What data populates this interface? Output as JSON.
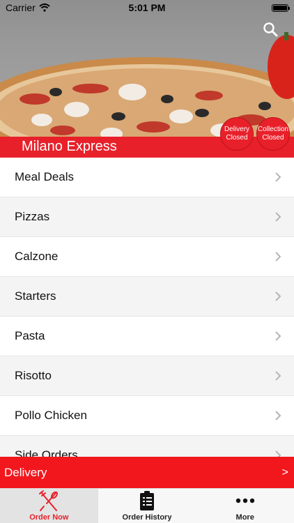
{
  "status_bar": {
    "carrier": "Carrier",
    "time": "5:01 PM",
    "wifi_icon": "wifi-icon",
    "battery_icon": "battery-icon"
  },
  "header": {
    "restaurant_name": "Milano Express",
    "search_icon": "search-icon",
    "accent_color": "#e8202a",
    "badges": {
      "delivery": {
        "line1": "Delivery",
        "line2": "Closed"
      },
      "collection": {
        "line1": "Collection",
        "line2": "Closed"
      }
    }
  },
  "menu": {
    "items": [
      {
        "label": "Meal Deals"
      },
      {
        "label": "Pizzas"
      },
      {
        "label": "Calzone"
      },
      {
        "label": "Starters"
      },
      {
        "label": "Pasta"
      },
      {
        "label": "Risotto"
      },
      {
        "label": "Pollo Chicken"
      },
      {
        "label": "Side Orders"
      }
    ],
    "chevron_icon": "chevron-right-icon"
  },
  "delivery_bar": {
    "label": "Delivery",
    "arrow": ">"
  },
  "tab_bar": {
    "tabs": [
      {
        "label": "Order Now",
        "icon": "fork-knife-icon",
        "active": true
      },
      {
        "label": "Order History",
        "icon": "clipboard-icon",
        "active": false
      },
      {
        "label": "More",
        "icon": "more-dots-icon",
        "active": false
      }
    ]
  }
}
